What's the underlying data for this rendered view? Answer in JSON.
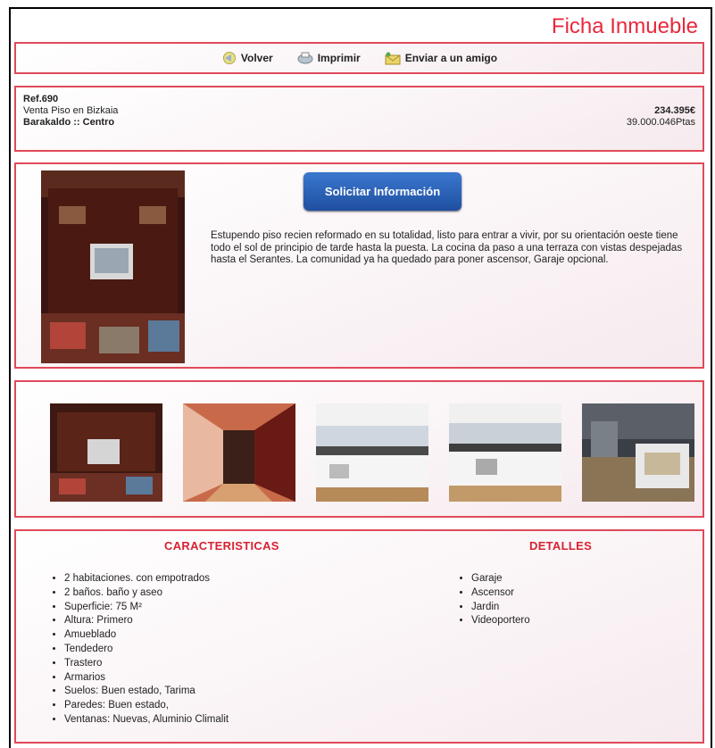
{
  "page_title": "Ficha Inmueble",
  "toolbar": {
    "back": "Volver",
    "print": "Imprimir",
    "send": "Enviar a un amigo"
  },
  "property": {
    "ref": "Ref.690",
    "type": "Venta Piso en Bizkaia",
    "location": "Barakaldo :: Centro",
    "price_eur": "234.395€",
    "price_pts": "39.000.046Ptas"
  },
  "request_button": "Solicitar Información",
  "description": "Estupendo piso recien reformado en su totalidad, listo para entrar a vivir, por su orientación oeste tiene todo el sol de principio de tarde hasta la puesta. La cocina da paso a una terraza con vistas despejadas hasta el Serantes. La comunidad ya ha quedado para poner ascensor, Garaje opcional.",
  "characteristics": {
    "title": "CARACTERISTICAS",
    "items": [
      "2 habitaciones. con empotrados",
      "2 baños. baño y aseo",
      "Superficie: 75 M²",
      "Altura: Primero",
      "Amueblado",
      "Tendedero",
      "Trastero",
      "Armarios",
      "Suelos: Buen estado, Tarima",
      "Paredes: Buen estado,",
      "Ventanas: Nuevas, Aluminio Climalit"
    ]
  },
  "details": {
    "title": "DETALLES",
    "items": [
      "Garaje",
      "Ascensor",
      "Jardin",
      "Videoportero"
    ]
  },
  "colors": {
    "accent": "#e8283c",
    "panel_border": "#e04a5a",
    "button": "#2a62b8"
  }
}
